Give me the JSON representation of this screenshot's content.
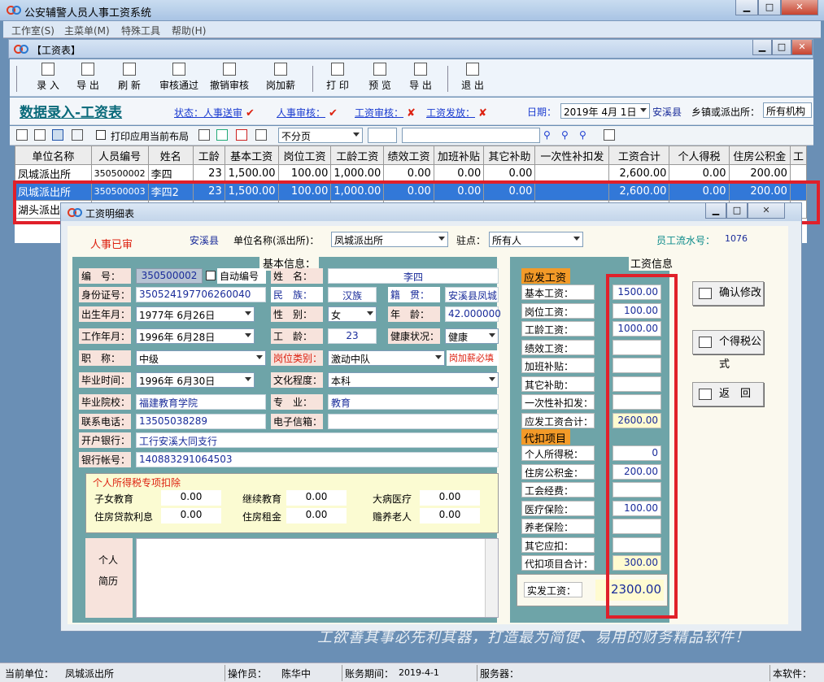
{
  "app": {
    "title": "公安辅警人员人事工资系统"
  },
  "menu": [
    "工作室(S)",
    "主菜单(M)",
    "特殊工具",
    "帮助(H)"
  ],
  "child_title": "【工资表】",
  "toolbar": {
    "items": [
      "录 入",
      "导 出",
      "刷 新",
      "审核通过",
      "撤销审核",
      "岗加薪",
      "打 印",
      "预 览",
      "导 出",
      "退 出"
    ]
  },
  "header": {
    "title": "数据录入-工资表",
    "status_label": "状态：",
    "hr_submit": "人事送审",
    "hr_review": "人事审核：",
    "wage_review": "工资审核：",
    "wage_pay": "工资发放：",
    "date_label": "日期：",
    "date_value": "2019年 4月 1日",
    "county": "安溪县",
    "town_label": "乡镇或派出所：",
    "town_value": "所有机构"
  },
  "tb2": {
    "print_layout": "打印应用当前布局",
    "paging": "不分页"
  },
  "grid": {
    "columns": [
      "单位名称",
      "人员编号",
      "姓名",
      "工龄",
      "基本工资",
      "岗位工资",
      "工龄工资",
      "绩效工资",
      "加班补贴",
      "其它补助",
      "一次性补扣发",
      "工资合计",
      "个人得税",
      "住房公积金",
      "工"
    ],
    "rows": [
      [
        "凤城派出所",
        "350500002",
        "李四",
        "23",
        "1,500.00",
        "100.00",
        "1,000.00",
        "0.00",
        "0.00",
        "0.00",
        "",
        "2,600.00",
        "0.00",
        "200.00"
      ],
      [
        "凤城派出所",
        "350500003",
        "李四2",
        "23",
        "1,500.00",
        "100.00",
        "1,000.00",
        "0.00",
        "0.00",
        "0.00",
        "",
        "2,600.00",
        "0.00",
        "200.00"
      ],
      [
        "湖头派出",
        "",
        "",
        "",
        "",
        "",
        "",
        "",
        "",
        "",
        "",
        "",
        "",
        ""
      ]
    ]
  },
  "dlg": {
    "title": "工资明细表",
    "hr_status": "人事已审",
    "county": "安溪县",
    "unit_label": "单位名称(派出所)：",
    "unit_value": "凤城派出所",
    "station_label": "驻点：",
    "station_value": "所有人",
    "serial_label": "员工流水号：",
    "serial_value": "1076",
    "basic_title": "基本信息：",
    "id_label": "编　号：",
    "id_value": "350500002",
    "auto_id": "自动编号",
    "name_label": "姓　名：",
    "name_value": "李四",
    "idcard_label": "身份证号：",
    "idcard_value": "350524197706260040",
    "ethnic_label": "民　族：",
    "ethnic_value": "汉族",
    "native_label": "籍　贯：",
    "native_value": "安溪县凤城",
    "birth_label": "出生年月：",
    "birth_value": "1977年 6月26日",
    "sex_label": "性　别：",
    "sex_value": "女",
    "age_label": "年　龄：",
    "age_value": "42.000000",
    "work_label": "工作年月：",
    "work_value": "1996年 6月28日",
    "seniority_label": "工　龄：",
    "seniority_value": "23",
    "health_label": "健康状况：",
    "health_value": "健康",
    "title_label": "职　称：",
    "title_value": "中级",
    "post_label": "岗位类别：",
    "post_value": "激动中队",
    "post_note": "岗加薪必填",
    "grad_label": "毕业时间：",
    "grad_value": "1996年 6月30日",
    "edu_label": "文化程度：",
    "edu_value": "本科",
    "school_label": "毕业院校：",
    "school_value": "福建教育学院",
    "major_label": "专　业：",
    "major_value": "教育",
    "phone_label": "联系电话：",
    "phone_value": "13505038289",
    "email_label": "电子信箱：",
    "email_value": "",
    "bank_label": "开户银行：",
    "bank_value": "工行安溪大同支行",
    "account_label": "银行帐号：",
    "account_value": "140883291064503",
    "tax_title": "个人所得税专项扣除",
    "tax": [
      [
        "子女教育",
        "0.00"
      ],
      [
        "继续教育",
        "0.00"
      ],
      [
        "大病医疗",
        "0.00"
      ],
      [
        "住房贷款利息",
        "0.00"
      ],
      [
        "住房租金",
        "0.00"
      ],
      [
        "赡养老人",
        "0.00"
      ]
    ],
    "resume_label1": "个人",
    "resume_label2": "简历",
    "wage_title": "工资信息",
    "pay_title": "应发工资",
    "pay": [
      [
        "基本工资：",
        "1500.00"
      ],
      [
        "岗位工资：",
        "100.00"
      ],
      [
        "工龄工资：",
        "1000.00"
      ],
      [
        "绩效工资：",
        ""
      ],
      [
        "加班补贴：",
        ""
      ],
      [
        "其它补助：",
        ""
      ],
      [
        "一次性补扣发：",
        ""
      ],
      [
        "应发工资合计：",
        "2600.00"
      ]
    ],
    "deduct_title": "代扣项目",
    "deduct": [
      [
        "个人所得税：",
        "0"
      ],
      [
        "住房公积金：",
        "200.00"
      ],
      [
        "工会经费：",
        ""
      ],
      [
        "医疗保险：",
        "100.00"
      ],
      [
        "养老保险：",
        ""
      ],
      [
        "其它应扣：",
        ""
      ],
      [
        "代扣项目合计：",
        "300.00"
      ]
    ],
    "net_label": "实发工资：",
    "net_value": "2300.00",
    "btn_confirm": "确认修改",
    "btn_tax": "个得税公式",
    "btn_back": "返　回"
  },
  "slogan": "工欲善其事必先利其器，打造最为简便、易用的财务精品软件！",
  "status": {
    "unit_label": "当前单位：",
    "unit": "凤城派出所",
    "op_label": "操作员：",
    "op": "陈华中",
    "period_label": "账务期间：",
    "period": "2019-4-1",
    "server_label": "服务器：",
    "version_label": "本软件："
  }
}
